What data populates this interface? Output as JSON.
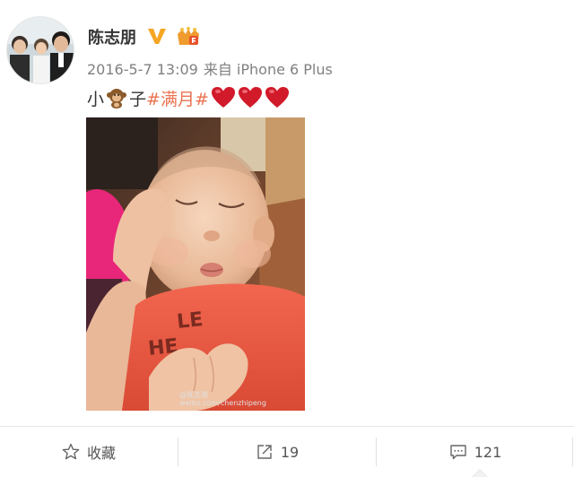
{
  "post": {
    "author": "陈志朋",
    "timestamp": "2016-5-7 13:09",
    "source": "来自 iPhone 6 Plus",
    "content": {
      "text_before": "小",
      "text_after": "子",
      "hashtag": "#满月#",
      "emoji": [
        "monkey",
        "red-heart",
        "red-heart",
        "red-heart"
      ]
    },
    "photo_watermark": {
      "line1": "@陈志朋",
      "line2": "weibo.com/chenzhipeng"
    },
    "badges": [
      "verified-v",
      "member-crown"
    ]
  },
  "actions": {
    "favorite_label": "收藏",
    "repost_count": "19",
    "comment_count": "121"
  },
  "colors": {
    "hashtag": "#eb7350",
    "verified": "#f5a623",
    "heart": "#d11a2a",
    "meta_text": "#808080"
  }
}
